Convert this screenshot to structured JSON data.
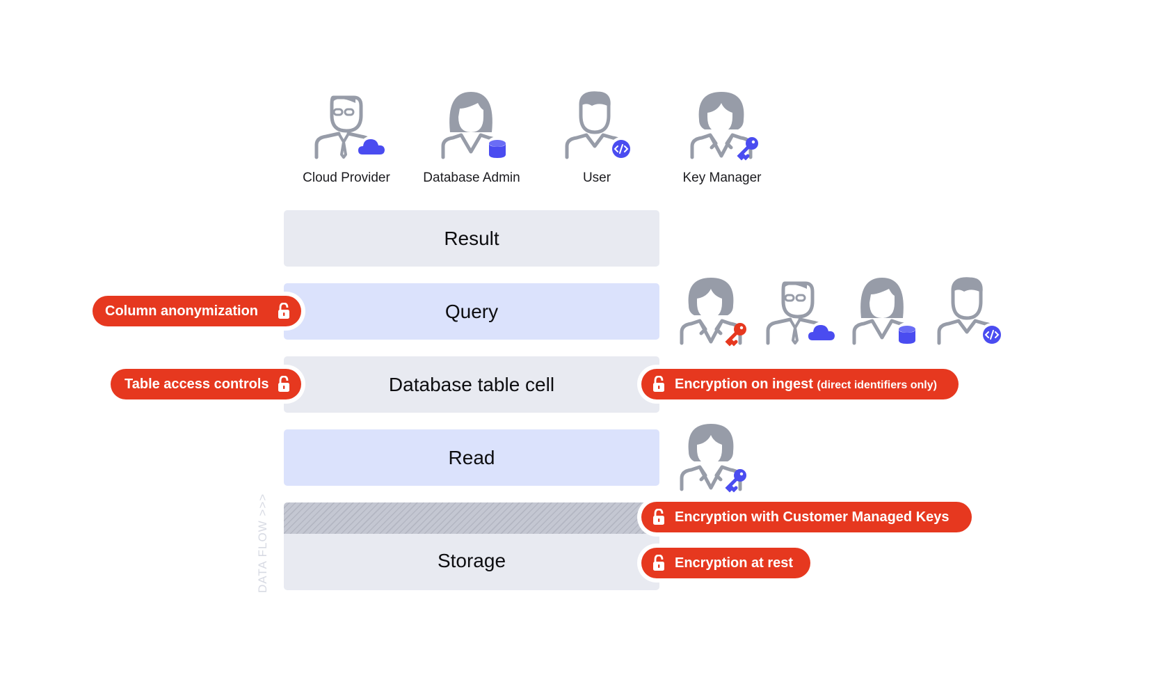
{
  "roles": [
    {
      "label": "Cloud Provider",
      "icon": "cloud-provider-person-icon",
      "badge": "cloud-icon"
    },
    {
      "label": "Database Admin",
      "icon": "database-admin-person-icon",
      "badge": "database-icon"
    },
    {
      "label": "User",
      "icon": "user-person-icon",
      "badge": "code-icon"
    },
    {
      "label": "Key Manager",
      "icon": "key-manager-person-icon",
      "badge": "key-icon"
    }
  ],
  "layers": [
    {
      "label": "Result",
      "tone": "gray"
    },
    {
      "label": "Query",
      "tone": "blue"
    },
    {
      "label": "Database table cell",
      "tone": "gray"
    },
    {
      "label": "Read",
      "tone": "blue"
    },
    {
      "label": "Storage",
      "tone": "gray"
    }
  ],
  "controls": {
    "column_anonymization": "Column anonymization",
    "table_access_controls": "Table access controls",
    "encryption_on_ingest": "Encryption on ingest",
    "encryption_on_ingest_note": "(direct identifiers only)",
    "encryption_cmk": "Encryption with Customer Managed Keys",
    "encryption_at_rest": "Encryption at rest"
  },
  "query_access_roles": [
    "Key Manager",
    "Cloud Provider",
    "Database Admin",
    "User"
  ],
  "read_access_roles": [
    "Key Manager"
  ],
  "data_flow_label": "DATA FLOW >>>",
  "colors": {
    "accent_red": "#e6381f",
    "accent_blue": "#4a4cf0",
    "person_gray": "#979ca8",
    "layer_gray": "#e8eaf1",
    "layer_blue": "#dbe2fc"
  }
}
